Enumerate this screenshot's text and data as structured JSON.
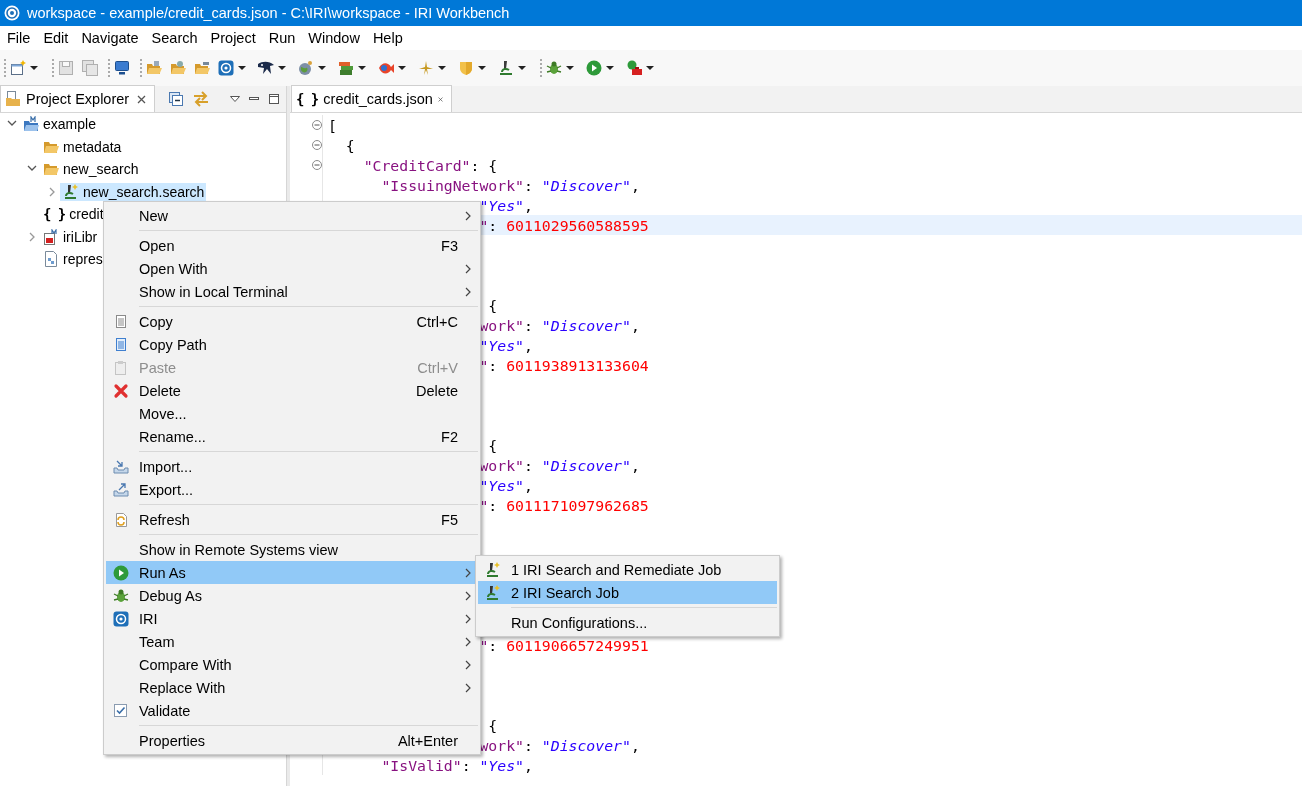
{
  "window": {
    "title": "workspace - example/credit_cards.json - C:\\IRI\\workspace - IRI Workbench"
  },
  "menu_bar": [
    "File",
    "Edit",
    "Navigate",
    "Search",
    "Project",
    "Run",
    "Window",
    "Help"
  ],
  "project_explorer": {
    "tab": {
      "label": "Project Explorer",
      "selected": true
    },
    "tree": [
      {
        "label": "example",
        "kind": "project",
        "expanded": true,
        "selected": false,
        "children": [
          {
            "label": "metadata",
            "kind": "folder",
            "selected": false
          },
          {
            "label": "new_search",
            "kind": "folder",
            "expanded": true,
            "selected": false,
            "children": [
              {
                "label": "new_search.search",
                "kind": "search",
                "expanded": false,
                "selected": true
              }
            ]
          },
          {
            "label": "credit",
            "kind": "json",
            "glyph": "{ }",
            "selected": false
          },
          {
            "label": "iriLibr",
            "kind": "library",
            "expanded": false,
            "selected": false
          },
          {
            "label": "repres",
            "kind": "file",
            "selected": false
          }
        ]
      }
    ]
  },
  "editor": {
    "tab": {
      "label": "credit_cards.json",
      "glyph": "{ }",
      "selected": true
    },
    "lines": [
      {
        "kind": "open-array",
        "current": false,
        "folded": false,
        "tokens": [
          {
            "text": "[",
            "kind": "punct"
          }
        ]
      },
      {
        "kind": "open-object",
        "current": false,
        "folded": false,
        "tokens": [
          {
            "text": "{",
            "kind": "punct"
          }
        ]
      },
      {
        "kind": "open-key",
        "current": false,
        "folded": false,
        "tokens": [
          {
            "text": "\"CreditCard\"",
            "kind": "key"
          },
          {
            "text": ": {",
            "kind": "punct"
          }
        ]
      },
      {
        "kind": "field",
        "current": false,
        "tokens": [
          {
            "text": "\"IssuingNetwork\"",
            "kind": "key"
          },
          {
            "text": ": ",
            "kind": "punct"
          },
          {
            "text": "\"Discover\"",
            "kind": "string"
          },
          {
            "text": ",",
            "kind": "punct"
          }
        ]
      },
      {
        "kind": "covered",
        "current": false,
        "tokens": [
          {
            "text": "\"Yes\"",
            "kind": "string"
          },
          {
            "text": ",",
            "kind": "punct"
          }
        ]
      },
      {
        "kind": "covered",
        "current": true,
        "tokens": [
          {
            "text": "\"",
            "kind": "key"
          },
          {
            "text": ": ",
            "kind": "punct"
          },
          {
            "text": "6011029560588595",
            "kind": "number"
          }
        ]
      },
      {
        "kind": "hidden",
        "current": false
      },
      {
        "kind": "hidden",
        "current": false
      },
      {
        "kind": "hidden",
        "current": false
      },
      {
        "kind": "covered-brace",
        "current": false,
        "tokens": [
          {
            "text": "{",
            "kind": "punct"
          }
        ]
      },
      {
        "kind": "covered",
        "current": false,
        "tokens": [
          {
            "text": "work\"",
            "kind": "key"
          },
          {
            "text": ": ",
            "kind": "punct"
          },
          {
            "text": "\"Discover\"",
            "kind": "string"
          },
          {
            "text": ",",
            "kind": "punct"
          }
        ]
      },
      {
        "kind": "covered",
        "current": false,
        "tokens": [
          {
            "text": "\"Yes\"",
            "kind": "string"
          },
          {
            "text": ",",
            "kind": "punct"
          }
        ]
      },
      {
        "kind": "covered",
        "current": false,
        "tokens": [
          {
            "text": "\"",
            "kind": "key"
          },
          {
            "text": ": ",
            "kind": "punct"
          },
          {
            "text": "6011938913133604",
            "kind": "number"
          }
        ]
      },
      {
        "kind": "hidden",
        "current": false
      },
      {
        "kind": "hidden",
        "current": false
      },
      {
        "kind": "hidden",
        "current": false
      },
      {
        "kind": "covered-brace",
        "current": false,
        "tokens": [
          {
            "text": "{",
            "kind": "punct"
          }
        ]
      },
      {
        "kind": "covered",
        "current": false,
        "tokens": [
          {
            "text": "work\"",
            "kind": "key"
          },
          {
            "text": ": ",
            "kind": "punct"
          },
          {
            "text": "\"Discover\"",
            "kind": "string"
          },
          {
            "text": ",",
            "kind": "punct"
          }
        ]
      },
      {
        "kind": "covered",
        "current": false,
        "tokens": [
          {
            "text": "\"Yes\"",
            "kind": "string"
          },
          {
            "text": ",",
            "kind": "punct"
          }
        ]
      },
      {
        "kind": "covered",
        "current": false,
        "tokens": [
          {
            "text": "\"",
            "kind": "key"
          },
          {
            "text": ": ",
            "kind": "punct"
          },
          {
            "text": "6011171097962685",
            "kind": "number"
          }
        ]
      },
      {
        "kind": "hidden",
        "current": false
      },
      {
        "kind": "hidden",
        "current": false
      },
      {
        "kind": "hidden",
        "current": false
      },
      {
        "kind": "hidden",
        "current": false
      },
      {
        "kind": "hidden",
        "current": false
      },
      {
        "kind": "hidden",
        "current": false
      },
      {
        "kind": "covered",
        "current": false,
        "tokens": [
          {
            "text": "\"",
            "kind": "key"
          },
          {
            "text": ": ",
            "kind": "punct"
          },
          {
            "text": "6011906657249951",
            "kind": "number"
          }
        ]
      },
      {
        "kind": "hidden",
        "current": false
      },
      {
        "kind": "hidden",
        "current": false
      },
      {
        "kind": "hidden",
        "current": false
      },
      {
        "kind": "covered-brace",
        "current": false,
        "tokens": [
          {
            "text": "{",
            "kind": "punct"
          }
        ]
      },
      {
        "kind": "covered",
        "current": false,
        "tokens": [
          {
            "text": "work\"",
            "kind": "key"
          },
          {
            "text": ": ",
            "kind": "punct"
          },
          {
            "text": "\"Discover\"",
            "kind": "string"
          },
          {
            "text": ",",
            "kind": "punct"
          }
        ]
      },
      {
        "kind": "field",
        "current": false,
        "tokens": [
          {
            "text": "\"IsValid\"",
            "kind": "key"
          },
          {
            "text": ": ",
            "kind": "punct"
          },
          {
            "text": "\"Yes\"",
            "kind": "string"
          },
          {
            "text": ",",
            "kind": "punct"
          }
        ]
      }
    ]
  },
  "context_menu": {
    "items": [
      {
        "kind": "item",
        "label": "New",
        "submenu": true,
        "disabled": false,
        "selected": false
      },
      {
        "kind": "separator"
      },
      {
        "kind": "item",
        "label": "Open",
        "shortcut": "F3",
        "submenu": false,
        "disabled": false,
        "selected": false
      },
      {
        "kind": "item",
        "label": "Open With",
        "submenu": true,
        "disabled": false,
        "selected": false
      },
      {
        "kind": "item",
        "label": "Show in Local Terminal",
        "submenu": true,
        "disabled": false,
        "selected": false
      },
      {
        "kind": "separator"
      },
      {
        "kind": "item",
        "label": "Copy",
        "shortcut": "Ctrl+C",
        "submenu": false,
        "disabled": false,
        "selected": false
      },
      {
        "kind": "item",
        "label": "Copy Path",
        "submenu": false,
        "disabled": false,
        "selected": false
      },
      {
        "kind": "item",
        "label": "Paste",
        "shortcut": "Ctrl+V",
        "submenu": false,
        "disabled": true,
        "selected": false
      },
      {
        "kind": "item",
        "label": "Delete",
        "shortcut": "Delete",
        "submenu": false,
        "disabled": false,
        "selected": false
      },
      {
        "kind": "item",
        "label": "Move...",
        "submenu": false,
        "disabled": false,
        "selected": false
      },
      {
        "kind": "item",
        "label": "Rename...",
        "shortcut": "F2",
        "submenu": false,
        "disabled": false,
        "selected": false
      },
      {
        "kind": "separator"
      },
      {
        "kind": "item",
        "label": "Import...",
        "submenu": false,
        "disabled": false,
        "selected": false
      },
      {
        "kind": "item",
        "label": "Export...",
        "submenu": false,
        "disabled": false,
        "selected": false
      },
      {
        "kind": "separator"
      },
      {
        "kind": "item",
        "label": "Refresh",
        "shortcut": "F5",
        "submenu": false,
        "disabled": false,
        "selected": false
      },
      {
        "kind": "separator"
      },
      {
        "kind": "item",
        "label": "Show in Remote Systems view",
        "submenu": false,
        "disabled": false,
        "selected": false
      },
      {
        "kind": "item",
        "label": "Run As",
        "submenu": true,
        "disabled": false,
        "selected": true
      },
      {
        "kind": "item",
        "label": "Debug As",
        "submenu": true,
        "disabled": false,
        "selected": false
      },
      {
        "kind": "item",
        "label": "IRI",
        "submenu": true,
        "disabled": false,
        "selected": false
      },
      {
        "kind": "item",
        "label": "Team",
        "submenu": true,
        "disabled": false,
        "selected": false
      },
      {
        "kind": "item",
        "label": "Compare With",
        "submenu": true,
        "disabled": false,
        "selected": false
      },
      {
        "kind": "item",
        "label": "Replace With",
        "submenu": true,
        "disabled": false,
        "selected": false
      },
      {
        "kind": "item",
        "label": "Validate",
        "submenu": false,
        "disabled": false,
        "selected": false
      },
      {
        "kind": "separator"
      },
      {
        "kind": "item",
        "label": "Properties",
        "shortcut": "Alt+Enter",
        "submenu": false,
        "disabled": false,
        "selected": false
      }
    ]
  },
  "run_as_submenu": {
    "items": [
      {
        "kind": "item",
        "label": "1 IRI Search and Remediate Job",
        "submenu": false,
        "disabled": false,
        "selected": false
      },
      {
        "kind": "item",
        "label": "2 IRI Search Job",
        "submenu": false,
        "disabled": false,
        "selected": true
      },
      {
        "kind": "separator"
      },
      {
        "kind": "item",
        "label": "Run Configurations...",
        "submenu": false,
        "disabled": false,
        "selected": false
      }
    ]
  }
}
